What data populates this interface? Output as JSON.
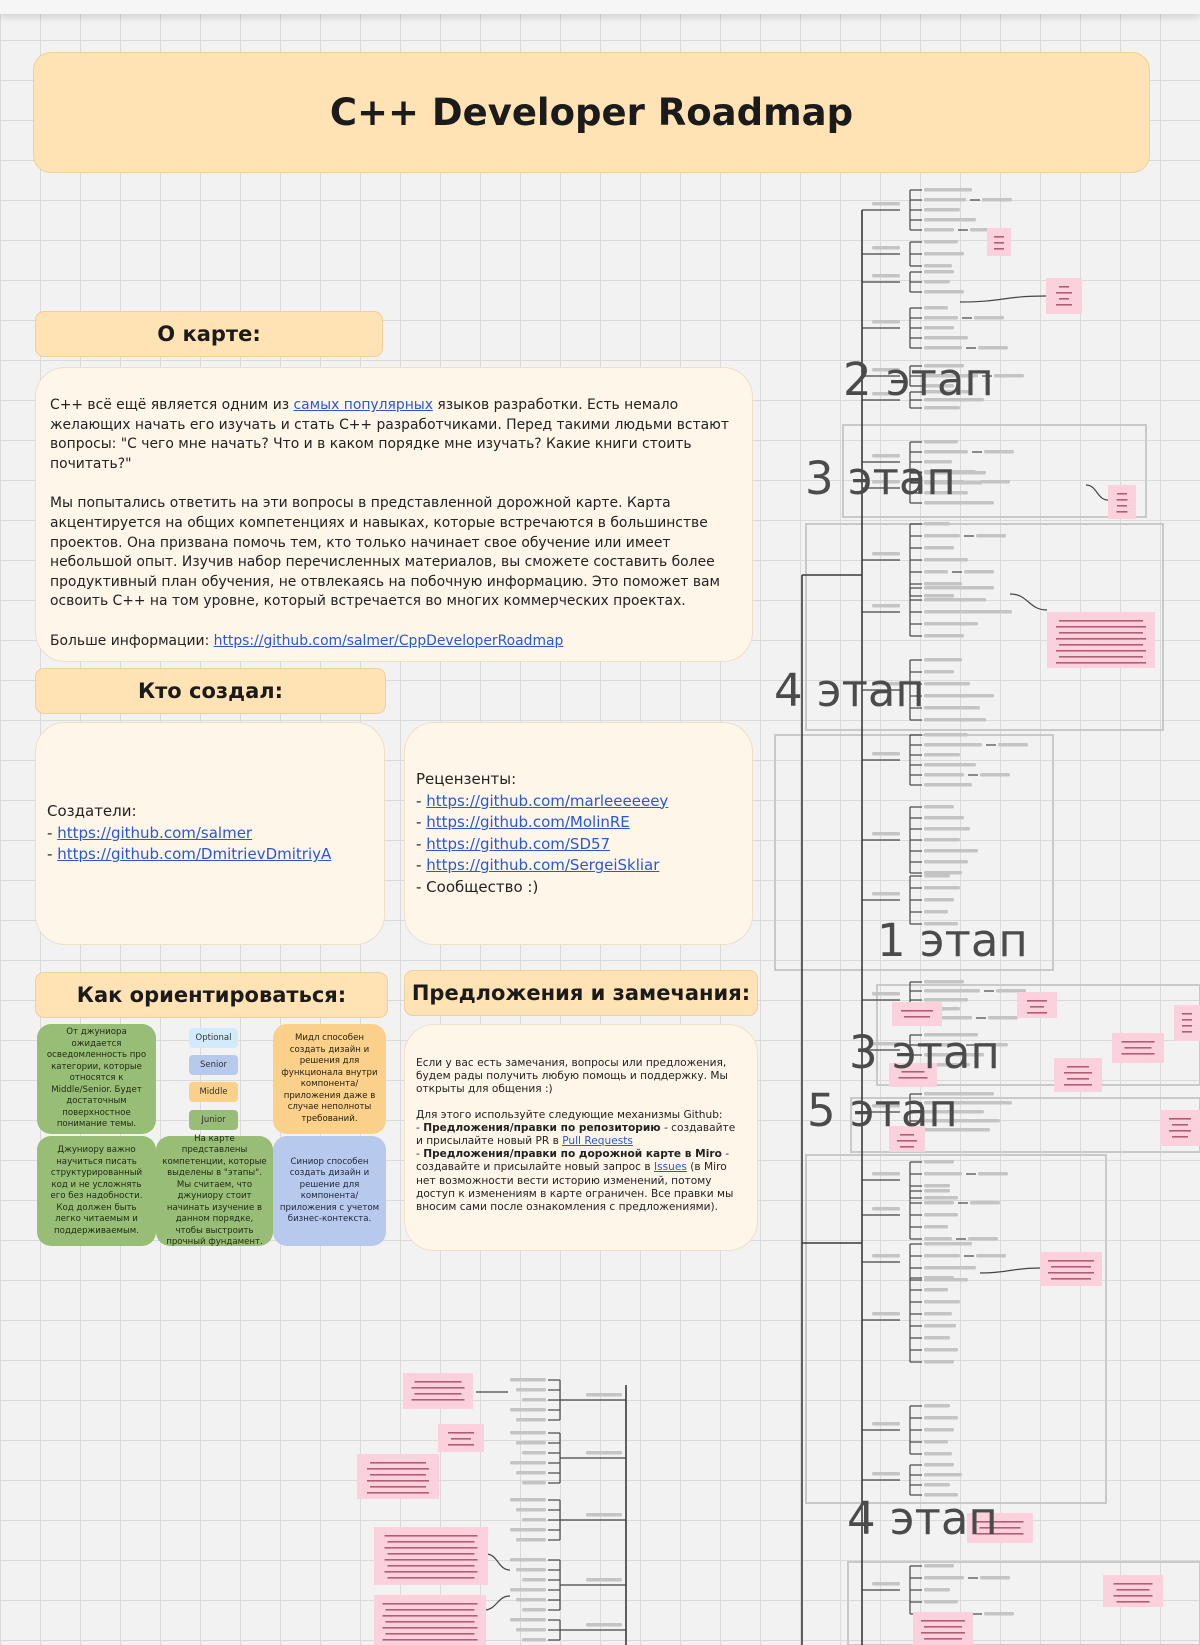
{
  "title": "C++ Developer Roadmap",
  "about": {
    "heading": "О карте:",
    "p1_before": "C++ всё ещё является одним из ",
    "p1_link": "самых популярных",
    "p1_after": " языков разработки. Есть немало желающих начать его изучать и стать C++ разработчиками. Перед такими людьми встают вопросы: \"С чего мне начать? Что и в каком порядке мне изучать? Какие книги стоить почитать?\"",
    "p2": "Мы попытались ответить на эти вопросы в представленной дорожной карте. Карта акцентируется на общих компетенциях и навыках, которые встречаются в большинстве проектов. Она призвана помочь тем, кто только начинает свое обучение или имеет небольшой опыт. Изучив набор перечисленных материалов, вы сможете составить более продуктивный план обучения, не отвлекаясь на побочную информацию. Это поможет вам освоить C++ на том уровне, который встречается во многих коммерческих проектах.",
    "more_label": "Больше информации: ",
    "more_link": "https://github.com/salmer/CppDeveloperRoadmap"
  },
  "creators": {
    "heading": "Кто создал:",
    "label": "Создатели:",
    "prefix": "- ",
    "links": [
      "https://github.com/salmer",
      "https://github.com/DmitrievDmitriyA"
    ]
  },
  "reviewers": {
    "label": "Рецензенты:",
    "prefix": "- ",
    "links": [
      "https://github.com/marleeeeeey",
      "https://github.com/MolinRE",
      "https://github.com/SD57",
      "https://github.com/SergeiSkliar"
    ],
    "community": "- Сообщество :)"
  },
  "orient": {
    "heading": "Как ориентироваться:",
    "tile_junior_expect": "От джуниора ожидается осведомленность про категории, которые относятся к Middle/Senior. Будет достаточным поверхностное понимание темы.",
    "tile_junior_code": "Джуниору важно научиться писать структурированный код и не усложнять его без надобности. Код должен быть легко читаемым и поддерживаемым.",
    "tile_stages": "На карте представлены компетенции, которые выделены в \"этапы\". Мы считаем, что джуниору стоит начинать изучение в данном порядке, чтобы выстроить прочный фундамент.",
    "tile_middle": "Мидл способен создать дизайн и решения для функционала внутри компонента/приложения даже в случае неполноты требований.",
    "tile_senior": "Синиор способен создать дизайн и решение для компонента/приложения с учетом бизнес-контекста.",
    "legend": [
      "Optional",
      "Senior",
      "Middle",
      "Junior"
    ]
  },
  "suggestions": {
    "heading": "Предложения и замечания:",
    "p1": "Если у вас есть замечания, вопросы или предложения, будем рады получить любую помощь и поддержку. Мы открыты для общения :)",
    "p2": "Для этого используйте следующие механизмы Github:",
    "item1_bold": "Предложения/правки по репозиторию",
    "item1_text": " - создавайте и присылайте новый PR в ",
    "item1_link": "Pull Requests",
    "item2_bold": "Предложения/правки по дорожной карте в Miro",
    "item2_text1": " - создавайте и присылайте новый запрос в ",
    "item2_link": "Issues",
    "item2_text2": " (в Miro нет возможности вести историю изменений, потому доступ к изменениям в карте ограничен. Все правки мы вносим сами после ознакомления с предложениями).",
    "dash": "- "
  },
  "stages": [
    "2 этап",
    "3 этап",
    "4 этап",
    "1 этап",
    "3 этап",
    "5 этап",
    "4 этап"
  ],
  "colors": {
    "banner": "#ffe3b4",
    "card": "#fff6ea",
    "link": "#2a57d6",
    "green_tile": "#97bd77",
    "orange_tile": "#fbd08a",
    "blue_tile": "#b7c9ec",
    "sticky_pink": "#fbd1dd",
    "optional": "#d2ebfa",
    "senior": "#b7c9ec",
    "middle": "#fbd08a",
    "junior": "#97bd77"
  }
}
